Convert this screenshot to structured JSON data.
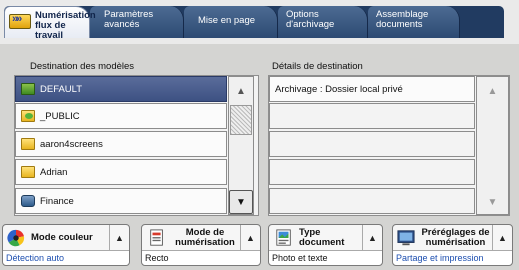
{
  "tabs": [
    {
      "label": "Numérisation flux de travail"
    },
    {
      "label": "Paramètres avancés"
    },
    {
      "label": "Mise en page"
    },
    {
      "label": "Options d'archivage"
    },
    {
      "label": "Assemblage documents"
    }
  ],
  "templates": {
    "title": "Destination des modèles",
    "items": [
      {
        "label": "DEFAULT",
        "icon": "green-folder-icon"
      },
      {
        "label": "_PUBLIC",
        "icon": "public-folder-icon"
      },
      {
        "label": "aaron4screens",
        "icon": "folder-icon"
      },
      {
        "label": "Adrian",
        "icon": "folder-icon"
      },
      {
        "label": "Finance",
        "icon": "database-icon"
      }
    ]
  },
  "details": {
    "title": "Détails de destination",
    "items": [
      {
        "label": "Archivage : Dossier local privé"
      },
      {
        "label": ""
      },
      {
        "label": ""
      },
      {
        "label": ""
      },
      {
        "label": ""
      }
    ]
  },
  "features": [
    {
      "label": "Mode couleur",
      "value": "Détection auto",
      "icon": "color-wheel-icon",
      "value_color": "#1d4fb0"
    },
    {
      "label": "Mode de numérisation",
      "value": "Recto",
      "icon": "scan-mode-icon",
      "value_color": "#111111"
    },
    {
      "label": "Type document",
      "value": "Photo et texte",
      "icon": "document-type-icon",
      "value_color": "#111111"
    },
    {
      "label": "Préréglages de numérisation",
      "value": "Partage et impression",
      "icon": "presets-icon",
      "value_color": "#1d4fb0"
    }
  ]
}
